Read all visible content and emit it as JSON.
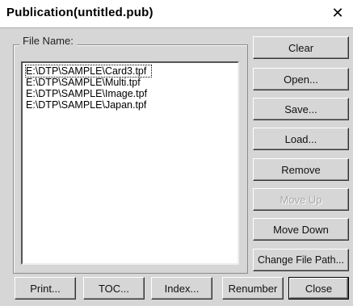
{
  "window": {
    "title": "Publication(untitled.pub)",
    "close_glyph": "✕"
  },
  "group": {
    "label": "File Name:"
  },
  "files": [
    "E:\\DTP\\SAMPLE\\Card3.tpf",
    "E:\\DTP\\SAMPLE\\Multi.tpf",
    "E:\\DTP\\SAMPLE\\Image.tpf",
    "E:\\DTP\\SAMPLE\\Japan.tpf"
  ],
  "side_buttons": {
    "clear": "Clear",
    "open": "Open...",
    "save": "Save...",
    "load": "Load...",
    "remove": "Remove",
    "move_up": "Move Up",
    "move_down": "Move Down",
    "change_path": "Change File Path..."
  },
  "bottom_buttons": {
    "print": "Print...",
    "toc": "TOC...",
    "index": "Index...",
    "renumber": "Renumber",
    "close": "Close"
  }
}
